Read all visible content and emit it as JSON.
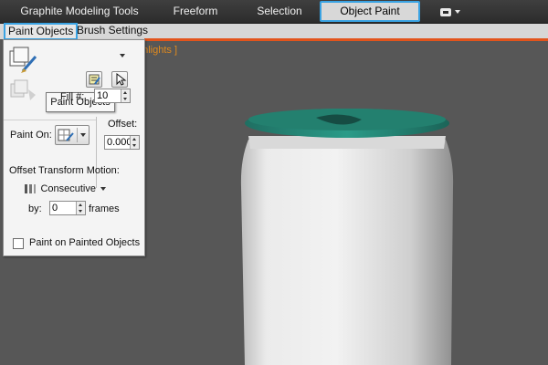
{
  "ribbon": {
    "tabs": [
      {
        "label": "Graphite Modeling Tools"
      },
      {
        "label": "Freeform"
      },
      {
        "label": "Selection"
      },
      {
        "label": "Object Paint"
      }
    ]
  },
  "subtabs": {
    "paint_objects": "Paint Objects",
    "brush_settings": "Brush Settings"
  },
  "viewport": {
    "label_fragment": "ghlights ]",
    "can_colors": {
      "body": "#e0e0e0",
      "lid": "#1f8a7a"
    }
  },
  "panel": {
    "tooltip": "Paint Objects",
    "fill_label": "Fill #:",
    "fill_value": "10",
    "paint_on_label": "Paint On:",
    "offset_label": "Offset:",
    "offset_value": "0.000",
    "offset_transform_label": "Offset Transform Motion:",
    "consecutive_label": "Consecutive",
    "by_label": "by:",
    "by_value": "0",
    "frames_label": "frames",
    "paint_on_painted_label": "Paint on Painted Objects"
  },
  "colors": {
    "accent_blue": "#3aa3e3",
    "orange_rule": "#e2541c",
    "viewport_bg": "#575757"
  }
}
